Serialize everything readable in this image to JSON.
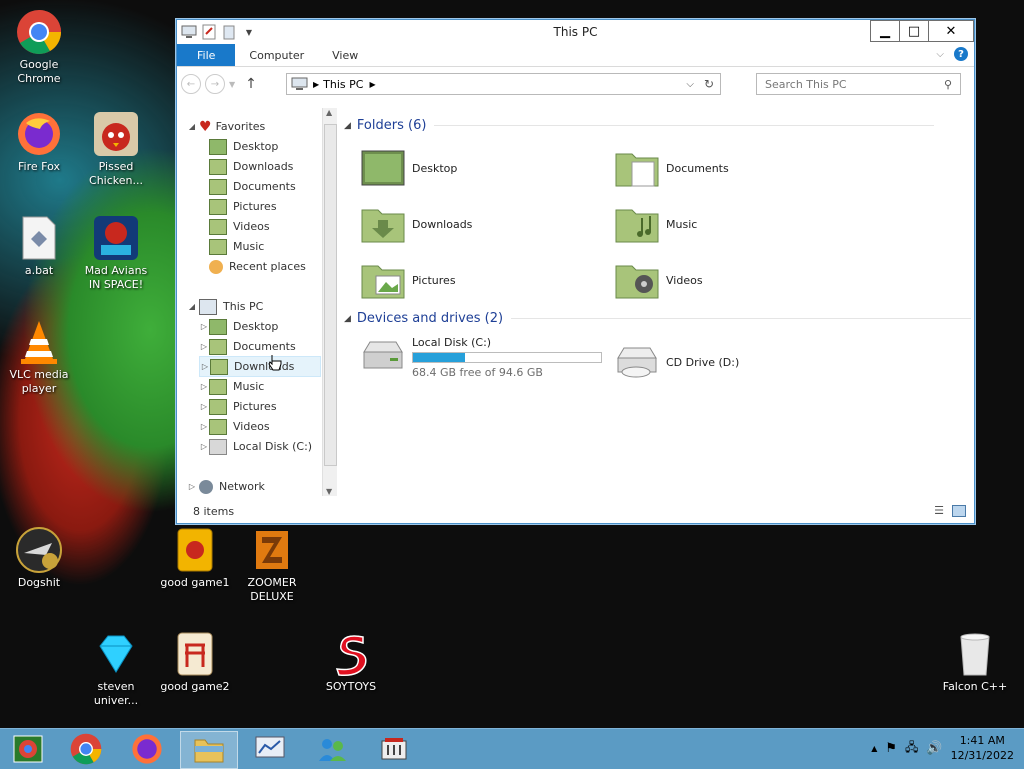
{
  "desktop": {
    "icons": [
      {
        "label": "Google Chrome"
      },
      {
        "label": "Fire Fox"
      },
      {
        "label": "a.bat"
      },
      {
        "label": "VLC media player"
      },
      {
        "label": "Pissed Chicken..."
      },
      {
        "label": "Mad Avians IN SPACE!"
      },
      {
        "label": "Dogshit"
      },
      {
        "label": "good game1"
      },
      {
        "label": "ZOOMER DELUXE"
      },
      {
        "label": "steven univer..."
      },
      {
        "label": "good game2"
      },
      {
        "label": "SOYTOYS"
      },
      {
        "label": "Falcon C++"
      }
    ]
  },
  "window": {
    "title": "This PC",
    "ribbon": {
      "file": "File",
      "computer": "Computer",
      "view": "View"
    },
    "address": {
      "path": "This PC"
    },
    "search": {
      "placeholder": "Search This PC"
    },
    "nav": {
      "favorites": "Favorites",
      "fav_items": [
        "Desktop",
        "Downloads",
        "Documents",
        "Pictures",
        "Videos",
        "Music",
        "Recent places"
      ],
      "this_pc": "This PC",
      "pc_items": [
        "Desktop",
        "Documents",
        "Downloads",
        "Music",
        "Pictures",
        "Videos",
        "Local Disk (C:)"
      ],
      "network": "Network"
    },
    "folders_header": "Folders (6)",
    "folders": [
      "Desktop",
      "Documents",
      "Downloads",
      "Music",
      "Pictures",
      "Videos"
    ],
    "devices_header": "Devices and drives (2)",
    "drives": {
      "c_label": "Local Disk (C:)",
      "c_free": "68.4 GB free of 94.6 GB",
      "c_used_fraction": 0.277,
      "d_label": "CD Drive (D:)"
    },
    "status": "8 items"
  },
  "taskbar": {
    "time": "1:41 AM",
    "date": "12/31/2022"
  },
  "colors": {
    "accent": "#1979ca",
    "taskbar": "#5b9bc4",
    "drive_fill": "#26a0da"
  }
}
